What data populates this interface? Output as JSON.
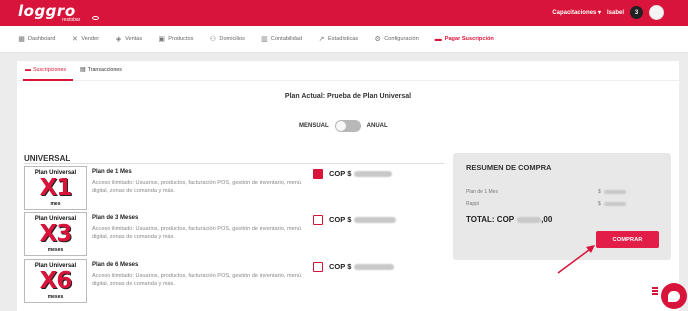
{
  "app": {
    "logo_text": "loggro",
    "logo_sub": "restobar",
    "user_menu": "Capacitaciones ▾",
    "user_name": "Isabel",
    "notification_count": "3"
  },
  "nav": {
    "items": [
      {
        "label": "Dashboard",
        "icon": "grid-icon"
      },
      {
        "label": "Vender",
        "icon": "cutlery-icon"
      },
      {
        "label": "Ventas",
        "icon": "tag-icon"
      },
      {
        "label": "Productos",
        "icon": "box-icon"
      },
      {
        "label": "Domicilios",
        "icon": "bike-icon"
      },
      {
        "label": "Contabilidad",
        "icon": "building-icon"
      },
      {
        "label": "Estadísticas",
        "icon": "trend-icon"
      },
      {
        "label": "Configuración",
        "icon": "gear-icon"
      },
      {
        "label": "Pagar Suscripción",
        "icon": "card-icon",
        "active": true
      }
    ]
  },
  "tabs": [
    {
      "label": "Suscripciones",
      "active": true
    },
    {
      "label": "Transacciones",
      "active": false
    }
  ],
  "plan": {
    "current_title": "Plan Actual: Prueba de Plan Universal",
    "toggle_left": "MENSUAL",
    "toggle_right": "ANUAL",
    "toggle_annual": false,
    "category": "UNIVERSAL"
  },
  "plans": [
    {
      "img_top": "Plan Universal",
      "img_big": "X1",
      "img_bottom": "mes",
      "name": "Plan de 1 Mes",
      "desc": "Acceso ilimitado: Usuarios, productos, facturación POS, gestión de inventario, menú digital, zonas de comanda y más.",
      "currency": "COP $",
      "selected": true
    },
    {
      "img_top": "Plan Universal",
      "img_big": "X3",
      "img_bottom": "meses",
      "name": "Plan de 3 Meses",
      "desc": "Acceso ilimitado: Usuarios, productos, facturación POS, gestión de inventario, menú digital, zonas de comanda y más.",
      "currency": "COP $",
      "selected": false
    },
    {
      "img_top": "Plan Universal",
      "img_big": "X6",
      "img_bottom": "meses",
      "name": "Plan de 6 Meses",
      "desc": "Acceso ilimitado: Usuarios, productos, facturación POS, gestión de inventario, menú digital, zonas de comanda y más.",
      "currency": "COP $",
      "selected": false
    }
  ],
  "summary": {
    "title": "RESUMEN DE COMPRA",
    "line1": "Plan de 1 Mes",
    "line2": "Rappi",
    "currency_symbol": "$",
    "total_label": "TOTAL: COP",
    "total_suffix": ",00",
    "buy_label": "COMPRAR"
  },
  "colors": {
    "brand": "#d9143a",
    "button": "#e11d48"
  }
}
